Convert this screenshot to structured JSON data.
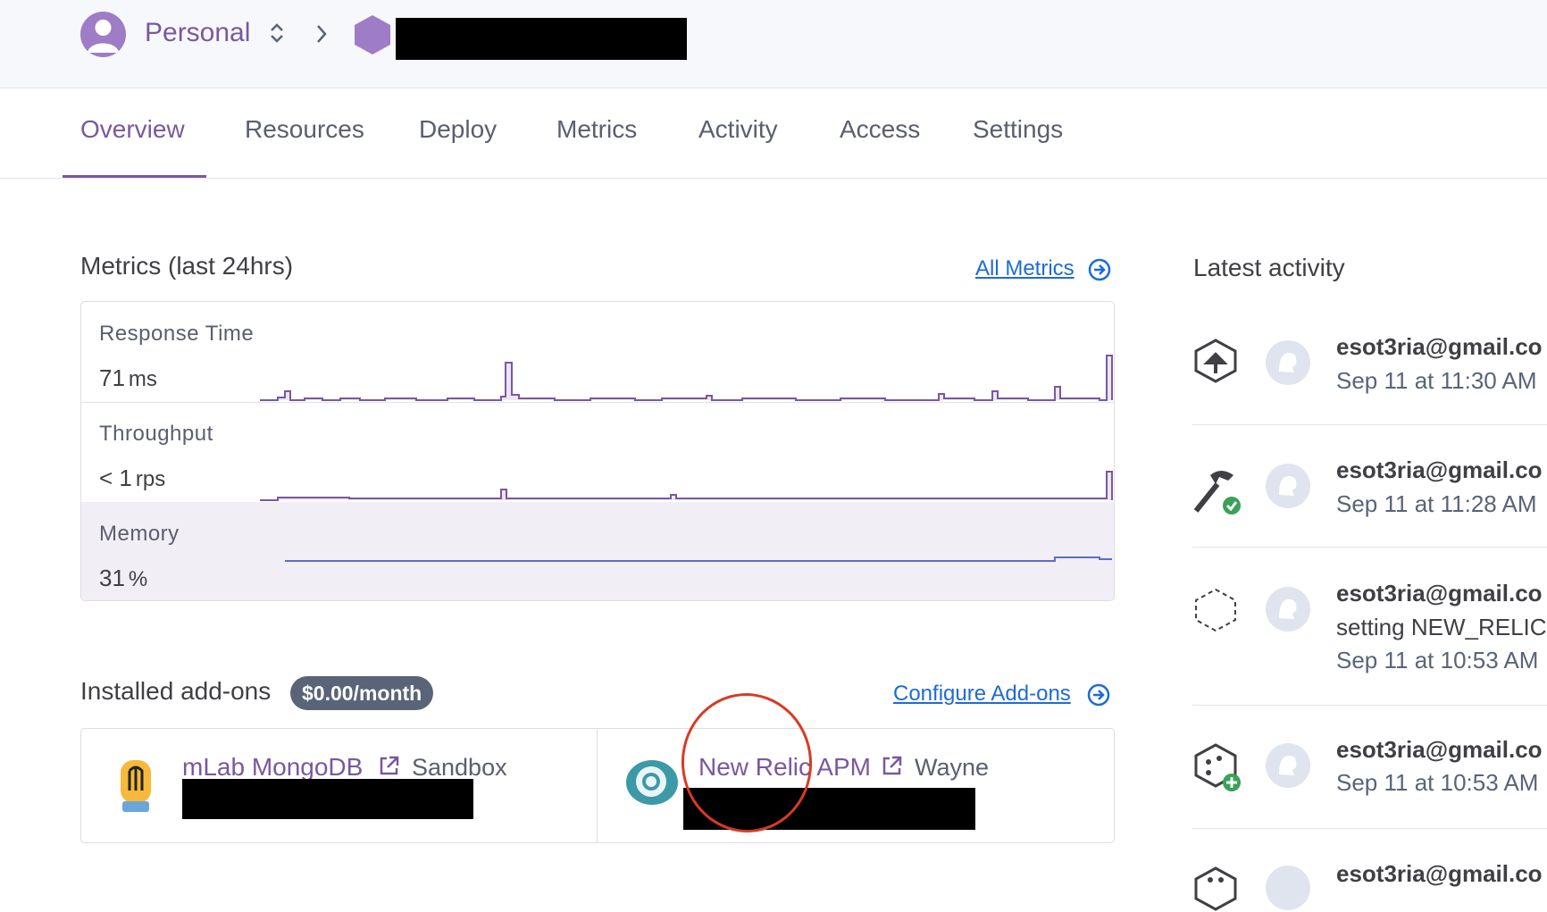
{
  "header": {
    "account_label": "Personal"
  },
  "tabs": [
    "Overview",
    "Resources",
    "Deploy",
    "Metrics",
    "Activity",
    "Access",
    "Settings"
  ],
  "active_tab": "Overview",
  "metrics": {
    "title": "Metrics (last 24hrs)",
    "all_link": "All Metrics",
    "rows": [
      {
        "label": "Response Time",
        "value": "71",
        "unit": "ms"
      },
      {
        "label": "Throughput",
        "value": "< 1",
        "unit": "rps"
      },
      {
        "label": "Memory",
        "value": "31",
        "unit": "%"
      }
    ]
  },
  "addons": {
    "title": "Installed add-ons",
    "price_badge": "$0.00/month",
    "configure_link": "Configure Add-ons",
    "items": [
      {
        "name": "mLab MongoDB",
        "plan": "Sandbox"
      },
      {
        "name": "New Relic APM",
        "plan": "Wayne"
      }
    ]
  },
  "activity": {
    "title": "Latest activity",
    "items": [
      {
        "user": "esot3ria@gmail.co",
        "time": "Sep 11 at 11:30 AM",
        "icon": "deploy-icon"
      },
      {
        "user": "esot3ria@gmail.co",
        "time": "Sep 11 at 11:28 AM",
        "icon": "build-success-icon"
      },
      {
        "user": "esot3ria@gmail.co",
        "desc": "setting NEW_RELIC",
        "time": "Sep 11 at 10:53 AM",
        "icon": "config-icon"
      },
      {
        "user": "esot3ria@gmail.co",
        "time": "Sep 11 at 10:53 AM",
        "icon": "addon-added-icon"
      },
      {
        "user": "esot3ria@gmail.co",
        "icon": "addon-icon"
      }
    ]
  },
  "colors": {
    "brand": "#79589f",
    "link": "#1d6bd6",
    "badge": "#596478",
    "annotation": "#d93a24"
  }
}
